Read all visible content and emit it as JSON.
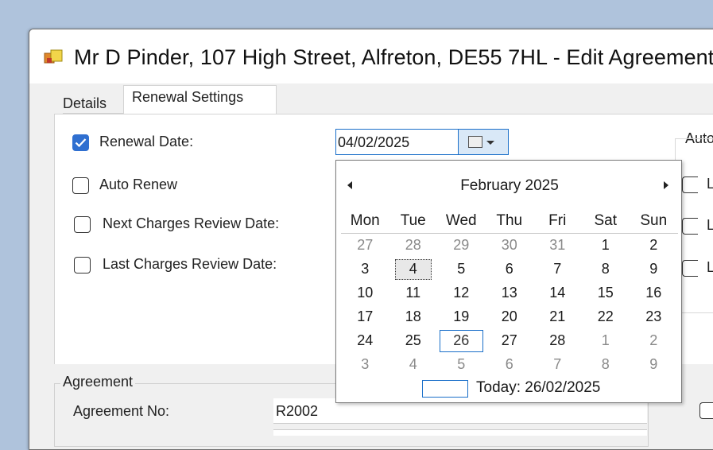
{
  "window": {
    "title": "Mr D Pinder, 107 High Street, Alfreton, DE55 7HL - Edit Agreement"
  },
  "tabs": [
    {
      "label": "Details",
      "active": false
    },
    {
      "label": "Renewal Settings",
      "active": true
    }
  ],
  "renewal": {
    "renewal_date_label": "Renewal Date:",
    "renewal_date_checked": true,
    "renewal_date_value": "04/02/2025",
    "auto_renew_label": "Auto Renew",
    "next_review_label": "Next Charges Review Date:",
    "last_review_label": "Last Charges Review Date:",
    "auto_group_label": "Auto",
    "right_labels": [
      "L",
      "L",
      "L"
    ]
  },
  "calendar": {
    "month_title": "February 2025",
    "weekdays": [
      "Mon",
      "Tue",
      "Wed",
      "Thu",
      "Fri",
      "Sat",
      "Sun"
    ],
    "weeks": [
      [
        "27",
        "28",
        "29",
        "30",
        "31",
        "1",
        "2"
      ],
      [
        "3",
        "4",
        "5",
        "6",
        "7",
        "8",
        "9"
      ],
      [
        "10",
        "11",
        "12",
        "13",
        "14",
        "15",
        "16"
      ],
      [
        "17",
        "18",
        "19",
        "20",
        "21",
        "22",
        "23"
      ],
      [
        "24",
        "25",
        "26",
        "27",
        "28",
        "1",
        "2"
      ],
      [
        "3",
        "4",
        "5",
        "6",
        "7",
        "8",
        "9"
      ]
    ],
    "selected_day": "4",
    "today_day": "26",
    "today_label": "Today: 26/02/2025"
  },
  "agreement": {
    "group_label": "Agreement",
    "agreement_no_label": "Agreement No:",
    "agreement_no_value": "R2002"
  },
  "colors": {
    "accent": "#1a6fc9",
    "checkbox_checked": "#2f6fd0",
    "desktop": "#afc3dc"
  }
}
